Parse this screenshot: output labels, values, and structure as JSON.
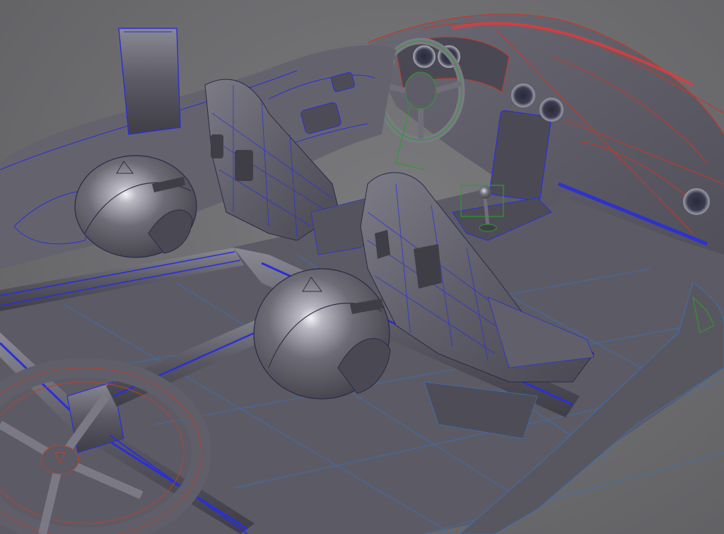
{
  "scene": {
    "background": "#6e6e70",
    "surface_color": "#5d5c66",
    "highlight_color": "#c9c8d2",
    "wire_colors": {
      "cage": "#2a2fd8",
      "floor": "#3a6fb8",
      "steering": "#2f9a2f",
      "shifter": "#2f9a2f",
      "dashboard": "#c0392b",
      "spare_wheel": "#b5432c"
    },
    "objects": [
      "roll-cage",
      "floor-pan",
      "driver-seat",
      "passenger-seat",
      "helmet-left",
      "helmet-right",
      "steering-wheel",
      "dashboard",
      "gauge-cluster",
      "gear-shifter",
      "spare-wheel",
      "door-panel"
    ]
  }
}
